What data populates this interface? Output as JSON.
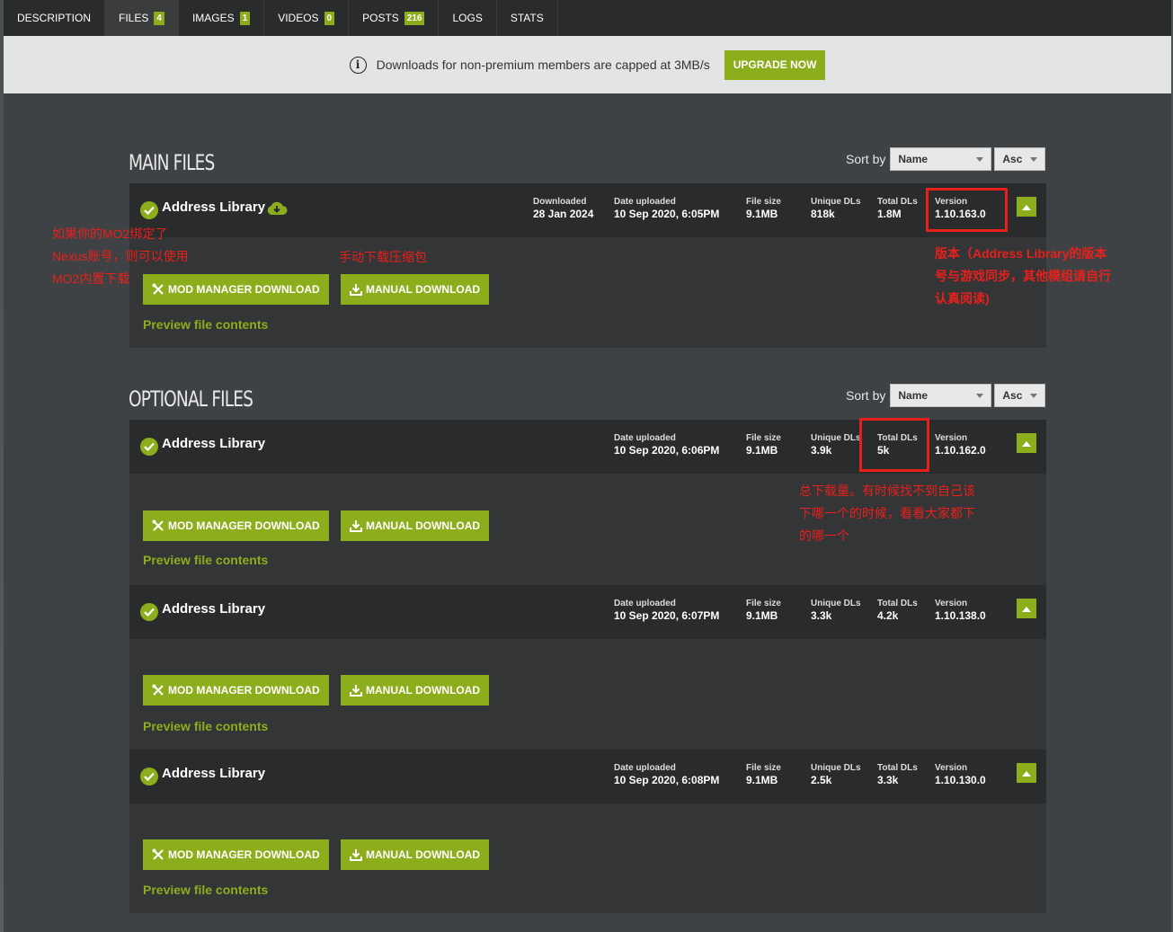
{
  "tabs": [
    {
      "label": "DESCRIPTION",
      "count": null,
      "active": false
    },
    {
      "label": "FILES",
      "count": "4",
      "active": true
    },
    {
      "label": "IMAGES",
      "count": "1",
      "active": false
    },
    {
      "label": "VIDEOS",
      "count": "0",
      "active": false
    },
    {
      "label": "POSTS",
      "count": "216",
      "active": false
    },
    {
      "label": "LOGS",
      "count": null,
      "active": false
    },
    {
      "label": "STATS",
      "count": null,
      "active": false
    }
  ],
  "notice": {
    "text": "Downloads for non-premium members are capped at 3MB/s",
    "button": "UPGRADE NOW",
    "icon": "info-icon"
  },
  "main_section": {
    "title": "MAIN FILES",
    "sort_label": "Sort by",
    "sort_field": "Name",
    "sort_order": "Asc"
  },
  "optional_section": {
    "title": "OPTIONAL FILES",
    "sort_label": "Sort by",
    "sort_field": "Name",
    "sort_order": "Asc"
  },
  "labels": {
    "downloaded": "Downloaded",
    "date_uploaded": "Date uploaded",
    "file_size": "File size",
    "unique_dls": "Unique DLs",
    "total_dls": "Total DLs",
    "version": "Version",
    "mod_manager_download": "MOD MANAGER DOWNLOAD",
    "manual_download": "MANUAL DOWNLOAD",
    "preview": "Preview file contents"
  },
  "main_file": {
    "name": "Address Library",
    "downloaded": "28 Jan 2024",
    "date_uploaded": "10 Sep 2020, 6:05PM",
    "file_size": "9.1MB",
    "unique_dls": "818k",
    "total_dls": "1.8M",
    "version": "1.10.163.0"
  },
  "optional_files": [
    {
      "name": "Address Library",
      "date_uploaded": "10 Sep 2020, 6:06PM",
      "file_size": "9.1MB",
      "unique_dls": "3.9k",
      "total_dls": "5k",
      "version": "1.10.162.0"
    },
    {
      "name": "Address Library",
      "date_uploaded": "10 Sep 2020, 6:07PM",
      "file_size": "9.1MB",
      "unique_dls": "3.3k",
      "total_dls": "4.2k",
      "version": "1.10.138.0"
    },
    {
      "name": "Address Library",
      "date_uploaded": "10 Sep 2020, 6:08PM",
      "file_size": "9.1MB",
      "unique_dls": "2.5k",
      "total_dls": "3.3k",
      "version": "1.10.130.0"
    }
  ],
  "annotations": {
    "mo2": [
      "如果你的MO2绑定了",
      "Nexus账号，则可以使用",
      "MO2内置下载"
    ],
    "manual": "手动下载压缩包",
    "version": [
      "版本（Address Library的版本",
      "号与游戏同步，其他模组请自行",
      "认真阅读)"
    ],
    "total": [
      "总下载量。有时候找不到自己该",
      "下哪一个的时候，看看大家都下",
      "的哪一个"
    ]
  },
  "colors": {
    "accent": "#8dae1c",
    "annotation": "#e8201c",
    "tabbar": "#2a2b2c",
    "card_head": "#2a2b2c",
    "card_body": "#333536"
  }
}
